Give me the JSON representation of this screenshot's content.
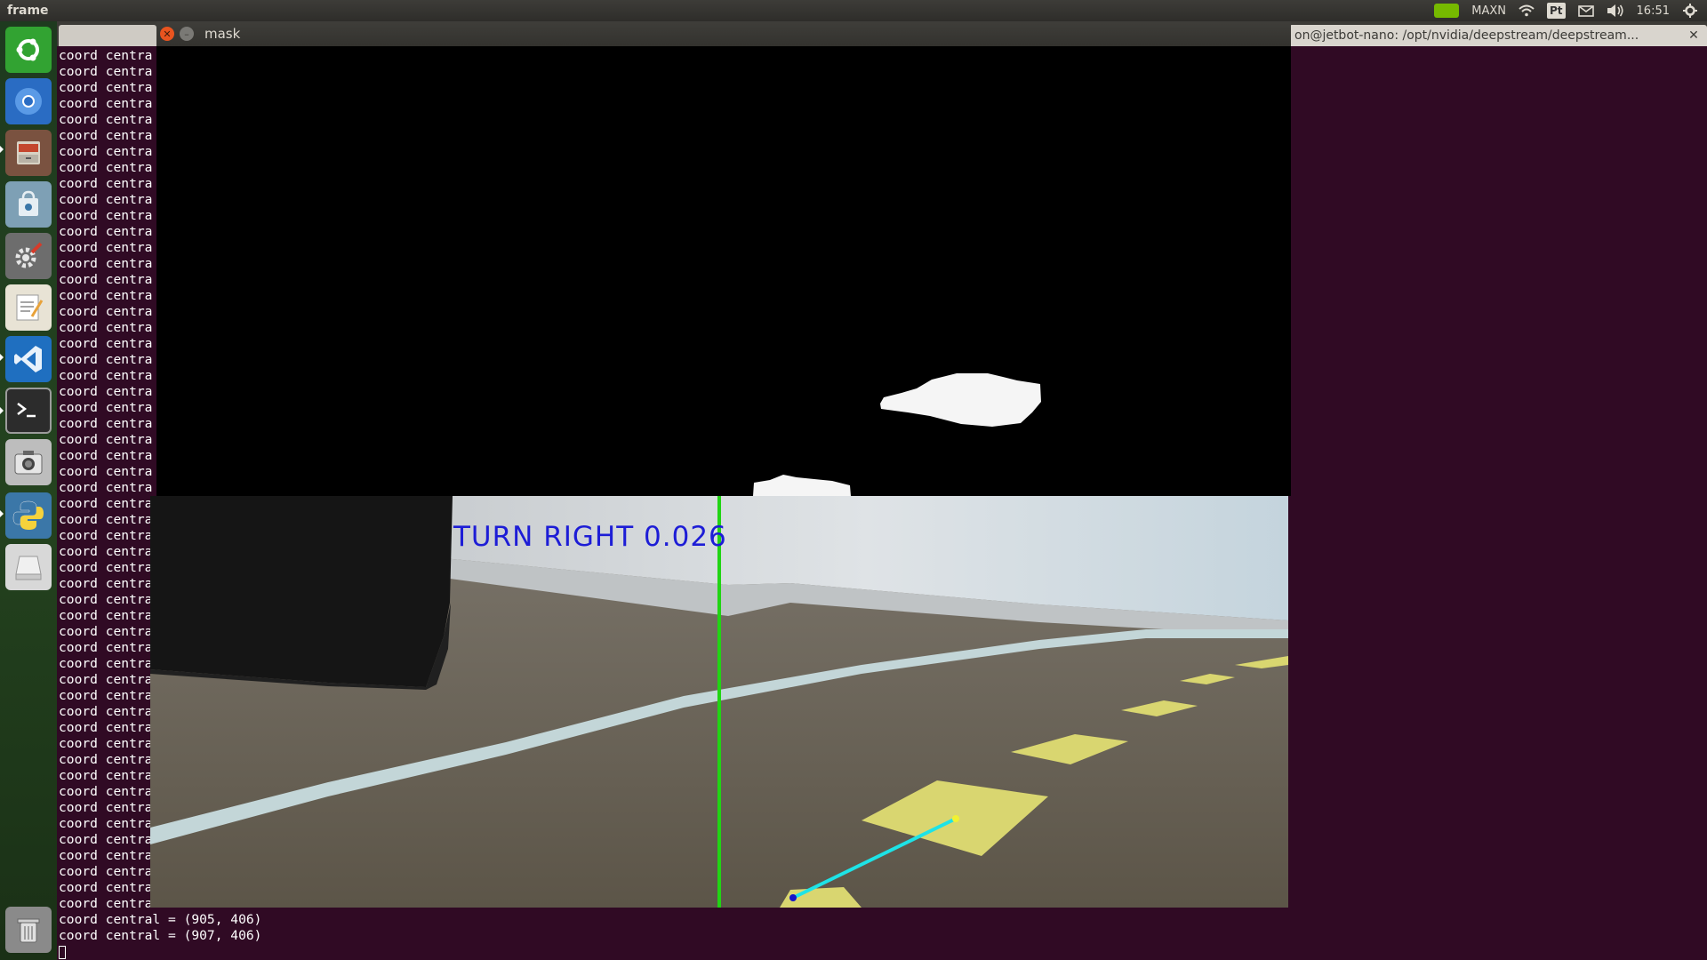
{
  "top_panel": {
    "app_title": "frame",
    "indicators": {
      "gpu_mode": "MAXN",
      "keyboard_layout": "Pt",
      "clock": "16:51"
    }
  },
  "launcher": {
    "items": [
      {
        "name": "ubuntu-dash",
        "icon": "ubuntu-logo-icon"
      },
      {
        "name": "chromium",
        "icon": "chromium-icon"
      },
      {
        "name": "files",
        "icon": "file-cabinet-icon"
      },
      {
        "name": "software-store",
        "icon": "shopping-bag-icon"
      },
      {
        "name": "system-settings",
        "icon": "gear-wrench-icon"
      },
      {
        "name": "text-editor",
        "icon": "notepad-icon"
      },
      {
        "name": "vscode",
        "icon": "vscode-icon"
      },
      {
        "name": "terminal",
        "icon": "terminal-icon"
      },
      {
        "name": "camera",
        "icon": "camera-icon"
      },
      {
        "name": "python",
        "icon": "python-icon"
      },
      {
        "name": "drive",
        "icon": "drive-icon"
      },
      {
        "name": "trash",
        "icon": "trash-icon"
      }
    ]
  },
  "terminal": {
    "tab_title": "on@jetbot-nano: /opt/nvidia/deepstream/deepstream...",
    "line_prefix": "coord centra",
    "repeated_line_count": 54,
    "last_lines": [
      "coord central = (905, 406)",
      "coord central = (907, 406)"
    ]
  },
  "mask_window": {
    "title": "mask"
  },
  "frame_window": {
    "overlay_text": "TURN  RIGHT 0.026"
  }
}
